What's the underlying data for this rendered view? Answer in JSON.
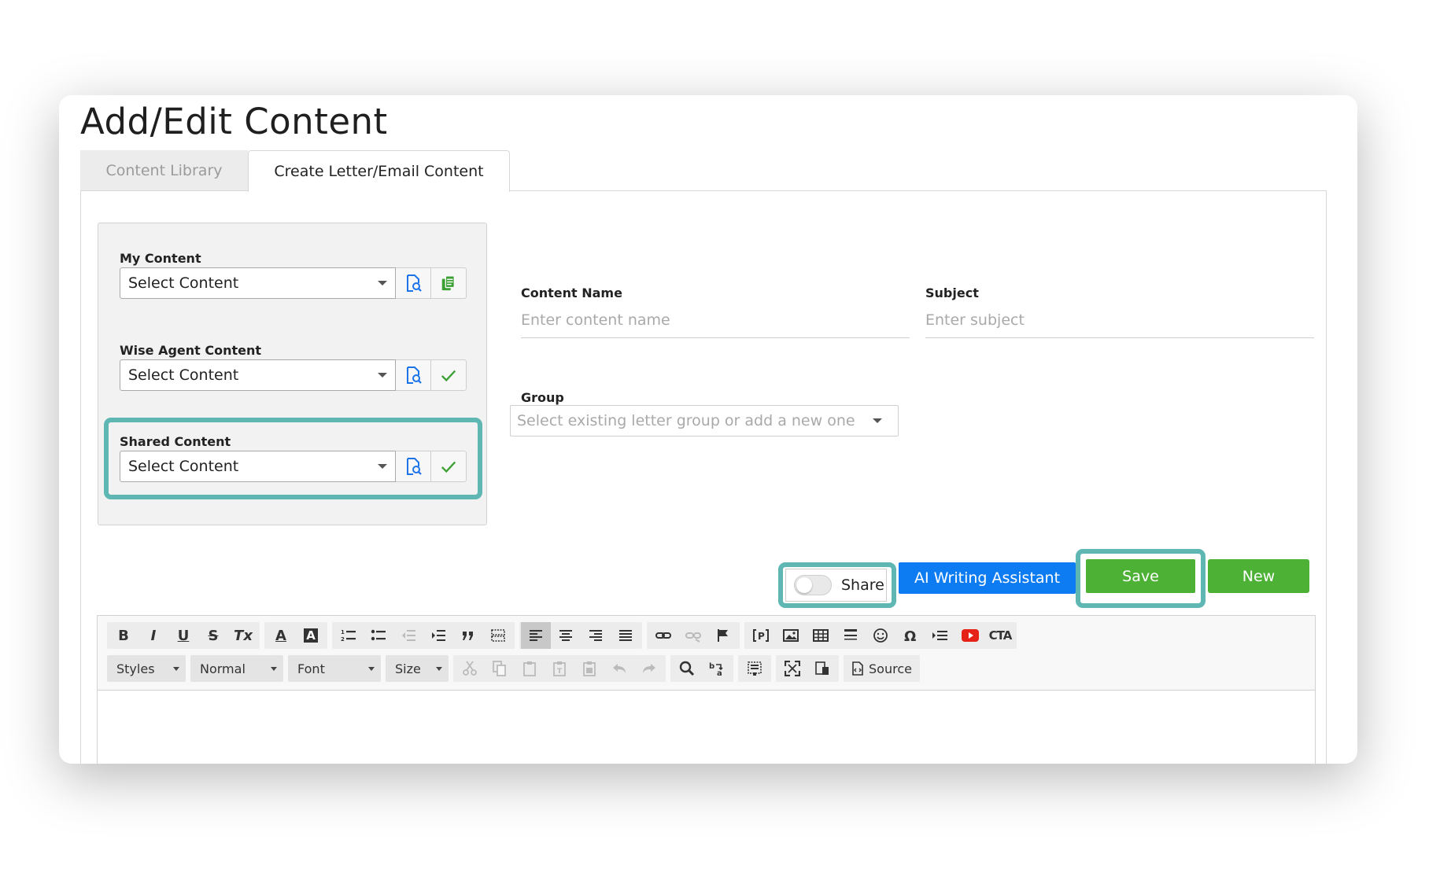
{
  "page": {
    "title": "Add/Edit Content"
  },
  "tabs": [
    {
      "label": "Content Library",
      "active": false
    },
    {
      "label": "Create Letter/Email Content",
      "active": true
    }
  ],
  "left_panel": {
    "my_content": {
      "label": "My Content",
      "value": "Select Content"
    },
    "wise_agent_content": {
      "label": "Wise Agent Content",
      "value": "Select Content"
    },
    "shared_content": {
      "label": "Shared Content",
      "value": "Select Content"
    }
  },
  "form": {
    "content_name": {
      "label": "Content Name",
      "placeholder": "Enter content name"
    },
    "subject": {
      "label": "Subject",
      "placeholder": "Enter subject"
    },
    "group": {
      "label": "Group",
      "placeholder": "Select existing letter group or add a new one"
    }
  },
  "actions": {
    "share_label": "Share",
    "share_on": false,
    "ai_label": "AI Writing Assistant",
    "save_label": "Save",
    "new_label": "New"
  },
  "editor": {
    "row1": {
      "bold": "B",
      "italic": "I",
      "underline": "U",
      "strike": "S",
      "remove_format": "Tx",
      "text_color": "A",
      "bg_color": "A",
      "cta": "CTA"
    },
    "styles_label": "Styles",
    "format_label": "Normal",
    "font_label": "Font",
    "size_label": "Size",
    "source_label": "Source"
  },
  "colors": {
    "highlight": "#5fb7b4",
    "primary_blue": "#0d7cf2",
    "success_green": "#4cb135",
    "icon_blue": "#1a73e8",
    "icon_green": "#3da035"
  }
}
